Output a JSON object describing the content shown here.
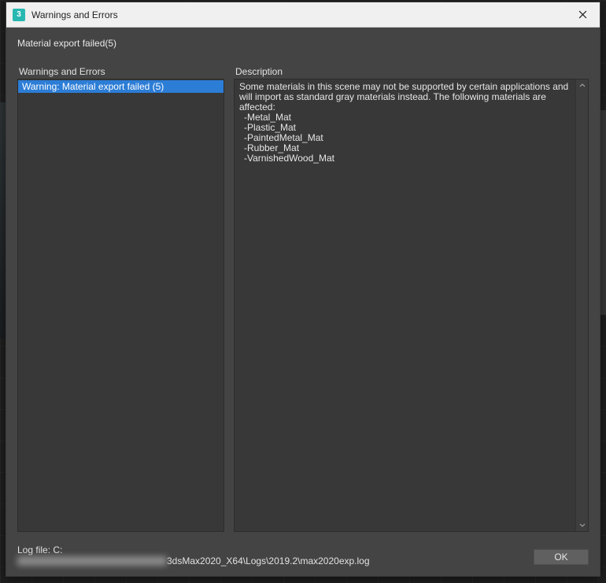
{
  "window": {
    "title": "Warnings and Errors",
    "app_icon_label": "3"
  },
  "subtitle": "Material export failed(5)",
  "panes": {
    "left": {
      "label": "Warnings and Errors"
    },
    "right": {
      "label": "Description"
    }
  },
  "warnings_list": [
    {
      "text": "Warning: Material export failed (5)",
      "selected": true
    }
  ],
  "description": {
    "intro": "Some materials in this scene may not be supported by certain applications and will import as standard gray materials instead. The following materials are affected:",
    "materials": [
      "-Metal_Mat",
      "-Plastic_Mat",
      "-PaintedMetal_Mat",
      "-Rubber_Mat",
      "-VarnishedWood_Mat"
    ]
  },
  "footer": {
    "log_label": "Log file: C:",
    "log_path_visible": "3dsMax2020_X64\\Logs\\2019.2\\max2020exp.log",
    "ok_label": "OK"
  }
}
